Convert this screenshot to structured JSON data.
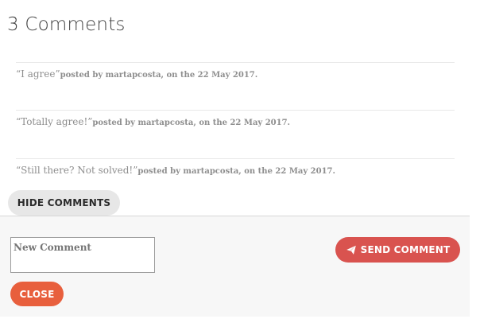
{
  "header": {
    "title": "3 Comments"
  },
  "comments": [
    {
      "text": "“I agree”",
      "meta": "posted by martapcosta, on the 22 May 2017."
    },
    {
      "text": "“Totally agree!”",
      "meta": "posted by martapcosta, on the 22 May 2017."
    },
    {
      "text": "“Still there? Not solved!”",
      "meta": "posted by martapcosta, on the 22 May 2017."
    }
  ],
  "actions": {
    "hide_comments_label": "HIDE COMMENTS",
    "send_comment_label": "SEND COMMENT",
    "close_label": "CLOSE"
  },
  "form": {
    "new_comment_placeholder": "New Comment"
  },
  "icons": {
    "send": "paper-plane-icon"
  },
  "colors": {
    "send_button": "#d9534f",
    "close_button": "#e85f3d"
  }
}
